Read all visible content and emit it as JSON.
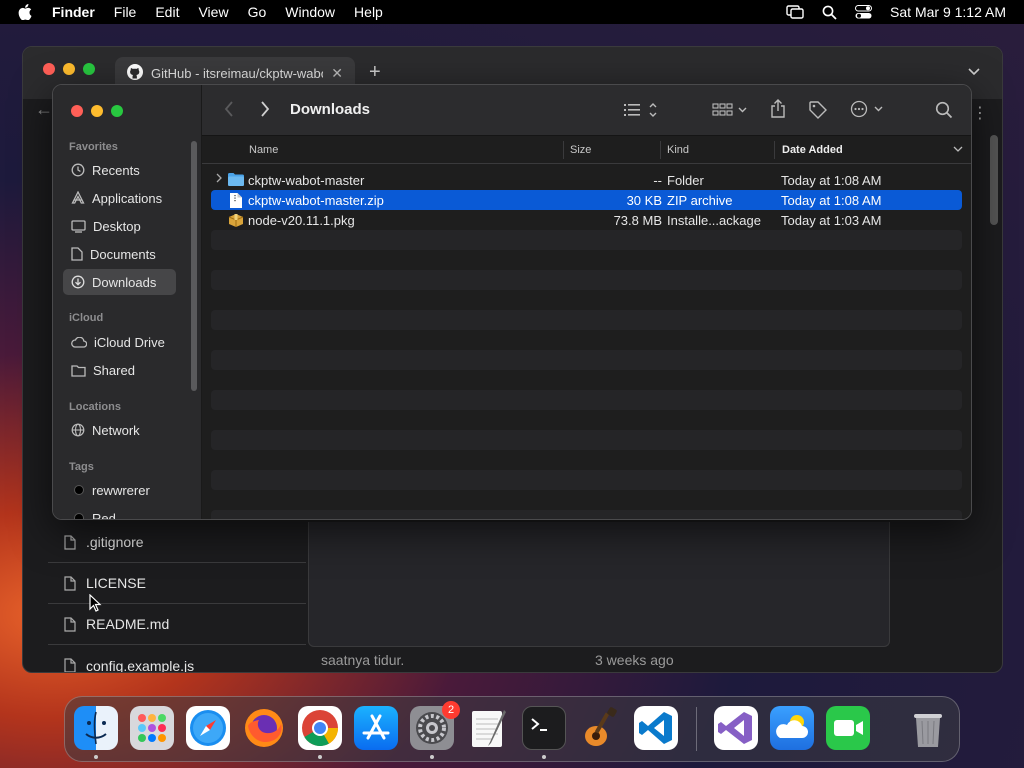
{
  "menubar": {
    "app": "Finder",
    "items": [
      "File",
      "Edit",
      "View",
      "Go",
      "Window",
      "Help"
    ],
    "datetime": "Sat Mar 9  1:12 AM"
  },
  "browser": {
    "tab_title": "GitHub - itsreimau/ckptw-wabot",
    "files": [
      ".gitignore",
      "LICENSE",
      "README.md",
      "config.example.js"
    ],
    "commit_message": "saatnya tidur.",
    "commit_time": "3 weeks ago"
  },
  "finder": {
    "title": "Downloads",
    "sidebar": {
      "favorites_label": "Favorites",
      "favorites": [
        "Recents",
        "Applications",
        "Desktop",
        "Documents",
        "Downloads"
      ],
      "icloud_label": "iCloud",
      "icloud": [
        "iCloud Drive",
        "Shared"
      ],
      "locations_label": "Locations",
      "locations": [
        "Network"
      ],
      "tags_label": "Tags",
      "tags": [
        "rewwrerer",
        "Red"
      ]
    },
    "columns": {
      "name": "Name",
      "size": "Size",
      "kind": "Kind",
      "date": "Date Added"
    },
    "rows": [
      {
        "name": "ckptw-wabot-master",
        "size": "--",
        "kind": "Folder",
        "date": "Today at 1:08 AM"
      },
      {
        "name": "ckptw-wabot-master.zip",
        "size": "30 KB",
        "kind": "ZIP archive",
        "date": "Today at 1:08 AM"
      },
      {
        "name": "node-v20.11.1.pkg",
        "size": "73.8 MB",
        "kind": "Installe...ackage",
        "date": "Today at 1:03 AM"
      }
    ]
  },
  "dock": {
    "settings_badge": "2"
  },
  "colors": {
    "selection": "#0a5ad6",
    "folder": "#4aa3e8"
  }
}
